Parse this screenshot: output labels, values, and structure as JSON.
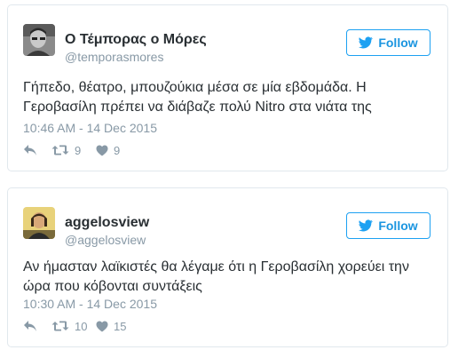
{
  "tweets": [
    {
      "name": "Ο Τέμπορας ο Μόρες",
      "handle": "@temporasmores",
      "follow_label": "Follow",
      "text": "Γήπεδο, θέατρο, μπουζούκια μέσα σε μία εβδομάδα. Η Γεροβασίλη πρέπει να διάβαζε πολύ Nitro στα νιάτα της",
      "timestamp": "10:46 AM - 14 Dec 2015",
      "retweets": "9",
      "likes": "9",
      "icons": {
        "reply": "reply-icon",
        "retweet": "retweet-icon",
        "like": "heart-icon",
        "follow": "bird-icon"
      }
    },
    {
      "name": "aggelosview",
      "handle": "@aggelosview",
      "follow_label": "Follow",
      "text": "Αν ήμασταν λαϊκιστές θα λέγαμε ότι η Γεροβασίλη χορεύει την ώρα που κόβονται συντάξεις",
      "timestamp": "10:30 AM - 14 Dec 2015",
      "retweets": "10",
      "likes": "15",
      "icons": {
        "reply": "reply-icon",
        "retweet": "retweet-icon",
        "like": "heart-icon",
        "follow": "bird-icon"
      }
    }
  ],
  "colors": {
    "accent": "#1da1f2",
    "follow_text": "#1b95e0",
    "muted": "#8899a6",
    "text": "#292f33",
    "border": "#e1e8ed"
  }
}
